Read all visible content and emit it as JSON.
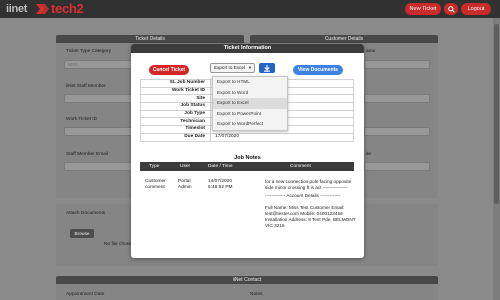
{
  "header": {
    "logo_left": "iinet",
    "logo_right": "tech2",
    "new_ticket_label": "New Ticket",
    "logout_label": "Logout"
  },
  "background": {
    "ticket_details_title": "Ticket Details",
    "customer_details_title": "Customer Details",
    "ticket_type_label": "Ticket Type Category",
    "ticket_type_value": "NFO",
    "staff_number_label": "iiNet Staff Member",
    "work_ticket_label": "Work Ticket ID",
    "staff_email_label": "Staff Member Email",
    "customer_name_label": "ame",
    "customer_other_label": "ite",
    "attach_label": "Attach Documents",
    "browse_label": "Browse",
    "no_file_label": "No file chosen",
    "contact_title": "iiNet Contact",
    "appointment_label": "Appointment Date",
    "notes_label": "Notes"
  },
  "modal": {
    "title": "Ticket Information",
    "cancel_label": "Cancel Ticket",
    "export_selected": "Export to Excel",
    "view_documents_label": "View Documents",
    "export_options": [
      "Export to HTML",
      "Export to Word",
      "Export to Excel",
      "Export to PowerPoint",
      "Export to WordPerfect"
    ],
    "highlighted_option": "Export to Excel",
    "info_rows": [
      {
        "key": "SL Job Number",
        "value": "3115"
      },
      {
        "key": "Work Ticket ID",
        "value": "7199"
      },
      {
        "key": "Site",
        "value": "LMONT VIC 3216"
      },
      {
        "key": "Job Status",
        "value": "en"
      },
      {
        "key": "Job Type",
        "value": "stallation"
      },
      {
        "key": "Technician",
        "value": "ne>"
      },
      {
        "key": "Timeslot",
        "value": "nd"
      },
      {
        "key": "Due Date",
        "value": "17/07/2020"
      }
    ],
    "notes_title": "Job Notes",
    "notes_columns": [
      "Type",
      "User",
      "Date / Time",
      "Comment"
    ],
    "note": {
      "type": "Customer comment",
      "user": "Portal Admin",
      "date": "14/07/2020",
      "time": "6:48:52 PM",
      "comment_lines": [
        "for a new connection pole facing opposite side minor crossing ft is act ----------------",
        "------------- Account Details -------------",
        "Full Name: Miss Test Customer Email: test@tester.com Mobile: 0400123456 Installation Address: 8 Test Pde, BELMONT VIC 3216"
      ]
    }
  }
}
